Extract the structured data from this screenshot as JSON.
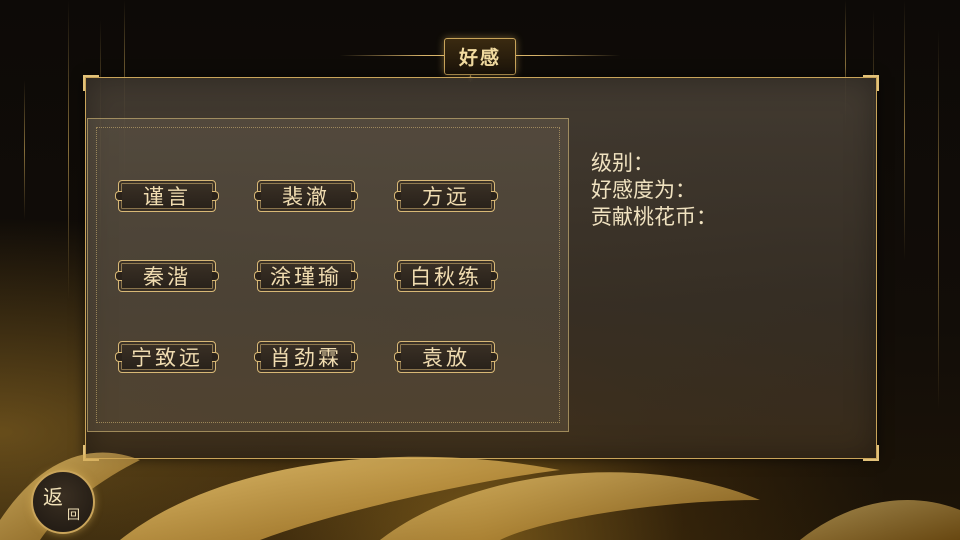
{
  "title": "好感",
  "title_ornament": "⚜",
  "characters": [
    {
      "name": "谨言"
    },
    {
      "name": "裴澈"
    },
    {
      "name": "方远"
    },
    {
      "name": "秦湝"
    },
    {
      "name": "涂瑾瑜"
    },
    {
      "name": "白秋练"
    },
    {
      "name": "宁致远"
    },
    {
      "name": "肖劲霖"
    },
    {
      "name": "袁放"
    }
  ],
  "info": {
    "level_label": "级别：",
    "affection_label": "好感度为：",
    "coins_label": "贡献桃花币："
  },
  "back_button": {
    "char_main": "返",
    "char_sub": "回"
  },
  "colors": {
    "accent_gold": "#c9a45a",
    "text_light": "#f0dcb0",
    "panel": "#463e34"
  }
}
